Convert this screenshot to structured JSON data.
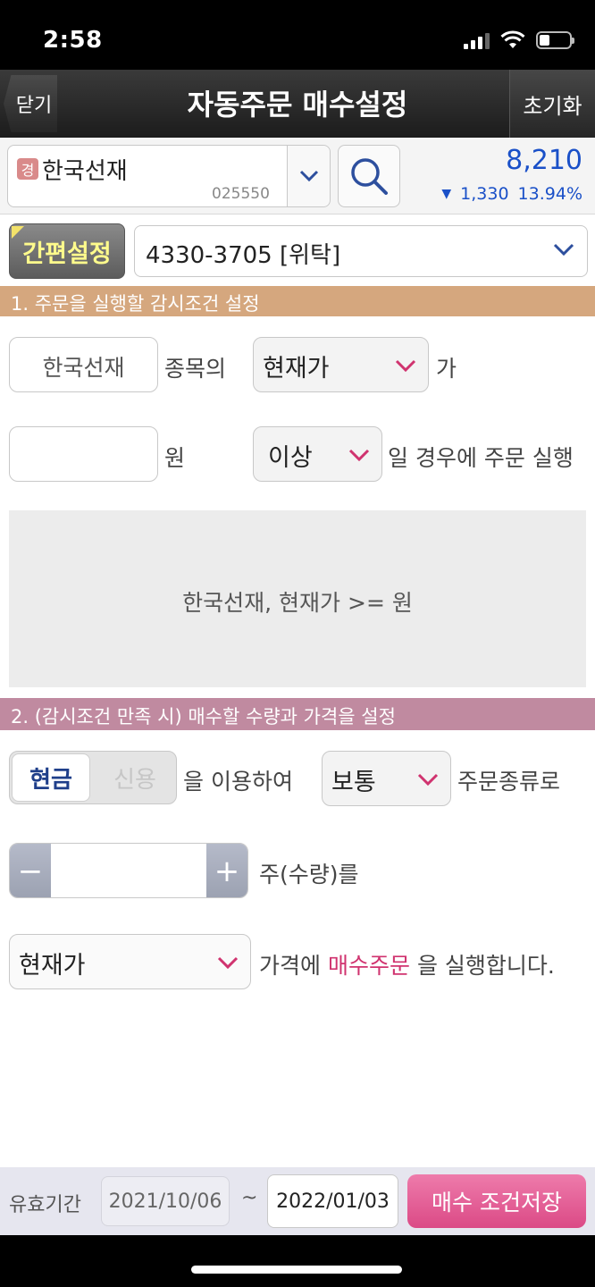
{
  "status_bar": {
    "time": "2:58",
    "battery_level": 0.35
  },
  "header": {
    "back_label": "닫기",
    "title": "자동주문 매수설정",
    "reset_label": "초기화"
  },
  "stock": {
    "badge": "경",
    "name": "한국선재",
    "code": "025550",
    "price": "8,210",
    "change_arrow": "▼",
    "change_amount": "1,330",
    "change_rate": "13.94%",
    "price_color": "#1a50c8"
  },
  "account": {
    "quick_label": "간편설정",
    "selected": "4330-3705 [위탁]"
  },
  "section1": {
    "title": "1. 주문을 실행할 감시조건 설정",
    "stock_field": "한국선재",
    "stock_suffix": "종목의",
    "condition_select": "현재가",
    "condition_suffix": "가",
    "price_value": "",
    "price_unit": "원",
    "compare_select": "이상",
    "compare_suffix": "일 경우에 주문 실행",
    "summary": "한국선재, 현재가 >= 원"
  },
  "section2": {
    "title": "2. (감시조건 만족 시) 매수할 수량과 가격을 설정",
    "pay_cash": "현금",
    "pay_credit": "신용",
    "pay_suffix": "을 이용하여",
    "order_type_select": "보통",
    "order_type_suffix": "주문종류로",
    "qty_minus": "−",
    "qty_value": "",
    "qty_plus": "+",
    "qty_suffix": "주(수량)를",
    "price_select": "현재가",
    "price_suffix_a": "가격에",
    "price_suffix_highlight": "매수주문",
    "price_suffix_b": "을 실행합니다."
  },
  "footer": {
    "valid_label": "유효기간",
    "date_start": "2021/10/06",
    "tilde": "~",
    "date_end": "2022/01/03",
    "save_label": "매수 조건저장"
  },
  "colors": {
    "accent_pink": "#d0336f",
    "section1": "#d5a77e",
    "section2": "#c08aa0"
  }
}
